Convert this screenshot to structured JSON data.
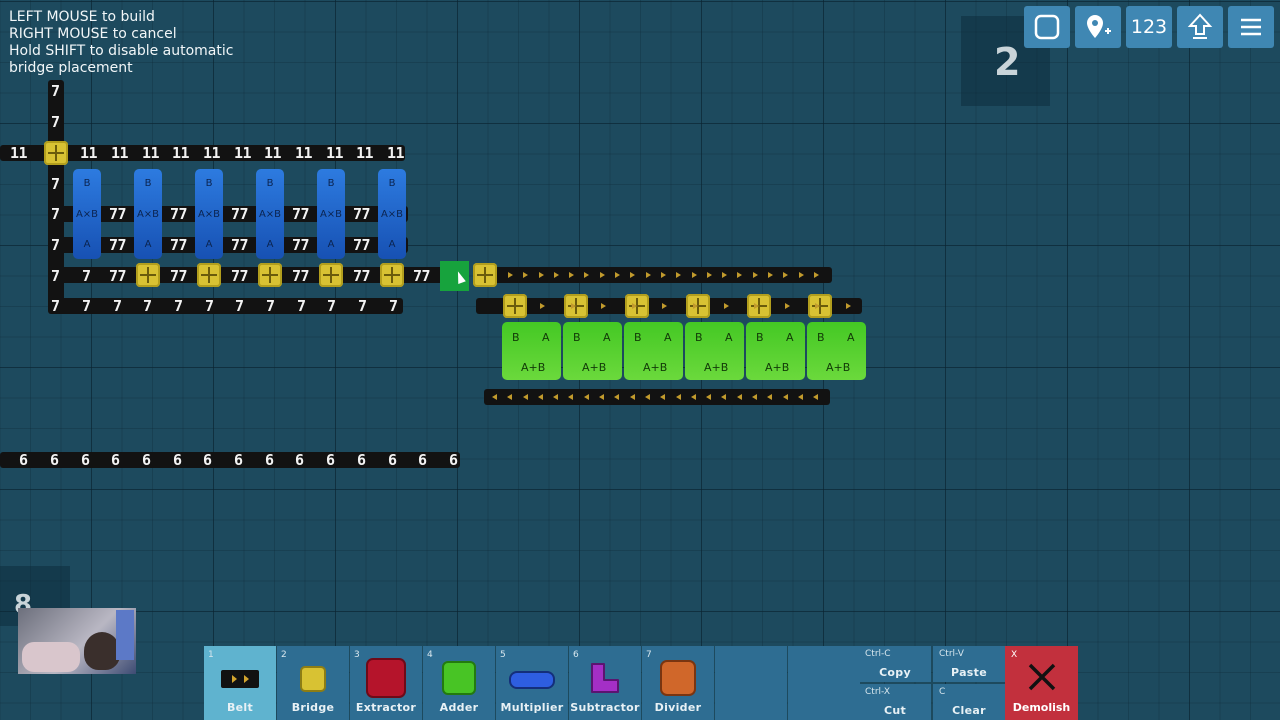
{
  "instructions": [
    "LEFT MOUSE to build",
    "RIGHT MOUSE to cancel",
    "Hold SHIFT to disable automatic",
    "bridge placement"
  ],
  "level": "2",
  "top_buttons": [
    {
      "icon": "square-icon"
    },
    {
      "icon": "add-marker-icon"
    },
    {
      "text": "123"
    },
    {
      "icon": "upload-arrow-icon"
    },
    {
      "icon": "menu-icon"
    }
  ],
  "belt_labels": {
    "left_feed": "7",
    "top_belt": "11",
    "product": "77",
    "bottom_belt": "7",
    "output": "77",
    "six_belt": "6"
  },
  "multiplier": {
    "in_b": "B",
    "op": "A×B",
    "in_a": "A"
  },
  "adder": {
    "in_b": "B",
    "in_a": "A",
    "op": "A+B"
  },
  "webcam_overlay_digit": "8",
  "toolbar": [
    {
      "key": "1",
      "label": "Belt",
      "color": "#111111"
    },
    {
      "key": "2",
      "label": "Bridge",
      "color": "#d8c233"
    },
    {
      "key": "3",
      "label": "Extractor",
      "color": "#b5142b"
    },
    {
      "key": "4",
      "label": "Adder",
      "color": "#48c425"
    },
    {
      "key": "5",
      "label": "Multiplier",
      "color": "#2e5ee0"
    },
    {
      "key": "6",
      "label": "Subtractor",
      "color": "#a42fc6"
    },
    {
      "key": "7",
      "label": "Divider",
      "color": "#d0672a"
    }
  ],
  "edit_buttons": [
    {
      "key": "Ctrl-C",
      "label": "Copy"
    },
    {
      "key": "Ctrl-V",
      "label": "Paste"
    },
    {
      "key": "Ctrl-X",
      "label": "Cut"
    },
    {
      "key": "C",
      "label": "Clear"
    }
  ],
  "demolish": {
    "key": "X",
    "label": "Demolish"
  }
}
